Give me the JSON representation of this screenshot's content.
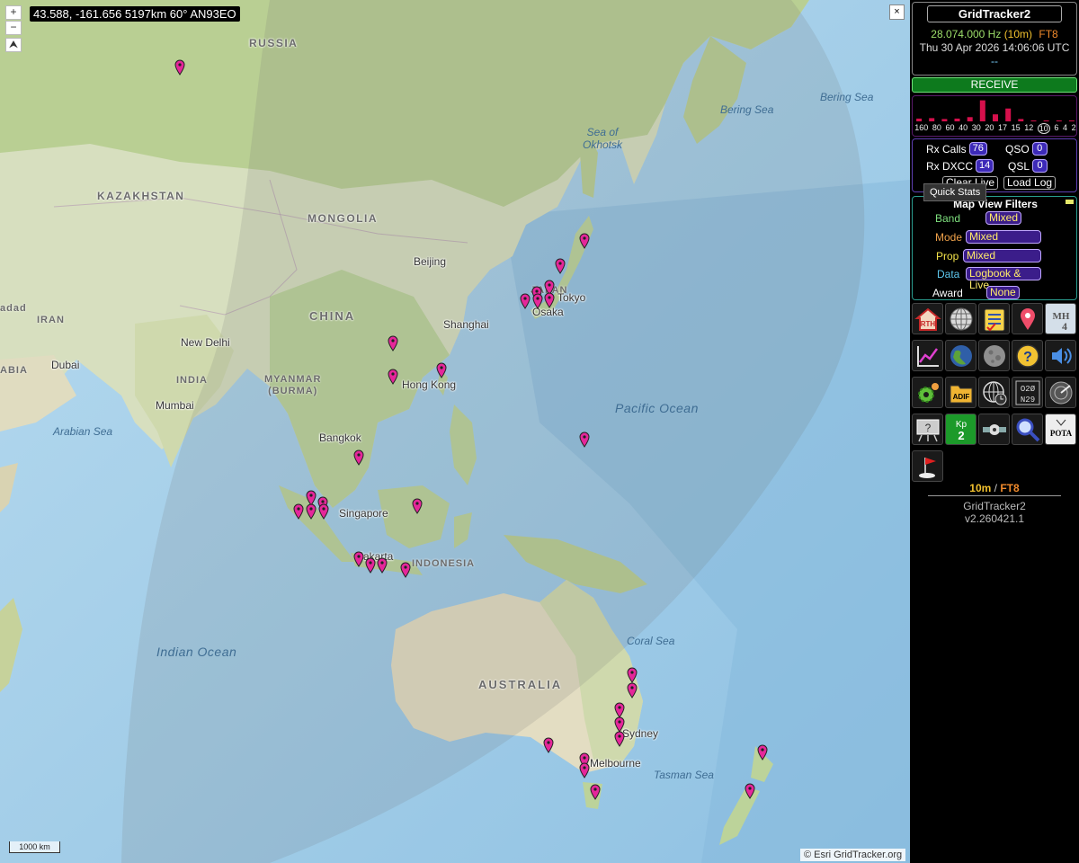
{
  "map": {
    "coordinate_readout": "43.588, -161.656 5197km 60° AN93EO",
    "zoom_in_label": "+",
    "zoom_out_label": "−",
    "north_label": "⮝",
    "close_label": "×",
    "scale_label": "1000 km",
    "attribution": "© Esri GridTracker.org",
    "labels": {
      "russia": "RUSSIA",
      "kazakhstan": "KAZAKHSTAN",
      "mongolia": "MONGOLIA",
      "china": "CHINA",
      "iran": "IRAN",
      "india": "INDIA",
      "myanmar": "MYANMAR\n(BURMA)",
      "indonesia": "INDONESIA",
      "australia": "AUSTRALIA",
      "japan": "JAPAN",
      "adad": "adad",
      "abia": "ABIA",
      "beijing": "Beijing",
      "shanghai": "Shanghai",
      "tokyo": "Tokyo",
      "osaka": "Osaka",
      "new_delhi": "New Delhi",
      "dubai": "Dubai",
      "mumbai": "Mumbai",
      "hong_kong": "Hong Kong",
      "bangkok": "Bangkok",
      "singapore": "Singapore",
      "jakarta": "Jakarta",
      "sydney": "Sydney",
      "melbourne": "Melbourne",
      "sea_of_okhotsk": "Sea of\nOkhotsk",
      "bering_sea_top": "Bering Sea",
      "bering_sea": "Bering Sea",
      "pacific_ocean": "Pacific Ocean",
      "arabian_sea": "Arabian Sea",
      "indian_ocean": "Indian Ocean",
      "coral_sea": "Coral Sea",
      "tasman_sea": "Tasman Sea"
    },
    "spot_color": "#e5279a"
  },
  "sidebar": {
    "app_title": "GridTracker2",
    "frequency": "28.074.000 Hz",
    "band_paren": "(10m)",
    "mode": "FT8",
    "datetime": "Thu 30 Apr 2026 14:06:06 UTC",
    "dashes": "--",
    "receive_label": "RECEIVE",
    "band_activity": {
      "labels": [
        "160",
        "80",
        "60",
        "40",
        "30",
        "20",
        "17",
        "15",
        "12",
        "10",
        "6",
        "4",
        "2"
      ],
      "active": "10",
      "values": [
        0.12,
        0.14,
        0.1,
        0.12,
        0.18,
        0.9,
        0.3,
        0.55,
        0.1,
        0.0,
        0.0,
        0.0,
        0.0
      ]
    },
    "stats": {
      "rx_calls_label": "Rx Calls",
      "rx_calls": "76",
      "qso_label": "QSO",
      "qso": "0",
      "rx_dxcc_label": "Rx DXCC",
      "rx_dxcc": "14",
      "qsl_label": "QSL",
      "qsl": "0",
      "clear_live": "Clear Live",
      "load_log": "Load Log",
      "tooltip": "Quick Stats"
    },
    "filters": {
      "title": "Map View Filters",
      "band_label": "Band",
      "band_value": "Mixed",
      "mode_label": "Mode",
      "mode_value": "Mixed",
      "prop_label": "Prop",
      "prop_value": "Mixed",
      "data_label": "Data",
      "data_value": "Logbook & Live",
      "award_label": "Award",
      "award_value": "None"
    },
    "tools": [
      "rth-home-icon",
      "globe-grid-icon",
      "checklist-icon",
      "map-pin-icon",
      "mh-4-icon",
      "chart-icon",
      "earth-icon",
      "moon-icon",
      "help-icon",
      "speaker-icon",
      "settings-icon",
      "adif-icon",
      "world-clock-icon",
      "grid-numbers-icon",
      "radar-icon",
      "question-card-icon",
      "kp-index-icon",
      "satellite-icon",
      "search-icon",
      "pota-icon",
      "golf-flag-icon"
    ],
    "tool_text": {
      "rth": "RTH",
      "mh": "MH",
      "mh_num": "4",
      "adif": "ADIF",
      "kp": "Kp",
      "kp_val": "2",
      "pota": "POTA",
      "grid_a": "O2Ø",
      "grid_b": "N29"
    },
    "footer_band": "10m",
    "footer_sep": " / ",
    "footer_mode": "FT8",
    "footer_name": "GridTracker2",
    "footer_version": "v2.260421.1"
  }
}
